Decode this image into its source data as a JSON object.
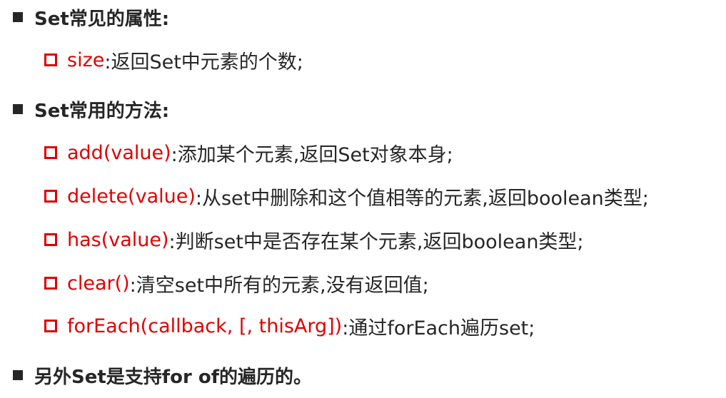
{
  "sections": [
    {
      "heading": "Set常见的属性:",
      "items": [
        {
          "name": "size",
          "desc": ":返回Set中元素的个数;"
        }
      ]
    },
    {
      "heading": "Set常用的方法:",
      "items": [
        {
          "name": "add(value)",
          "desc": ":添加某个元素,返回Set对象本身;"
        },
        {
          "name": "delete(value)",
          "desc": ":从set中删除和这个值相等的元素,返回boolean类型;"
        },
        {
          "name": "has(value)",
          "desc": ":判断set中是否存在某个元素,返回boolean类型;"
        },
        {
          "name": "clear()",
          "desc": ":清空set中所有的元素,没有返回值;"
        },
        {
          "name": "forEach(callback, [, thisArg])",
          "desc": ":通过forEach遍历set;"
        }
      ]
    },
    {
      "heading": "另外Set是支持for of的遍历的。",
      "items": []
    }
  ],
  "colors": {
    "keyword": "#e00000",
    "text": "#262626"
  }
}
